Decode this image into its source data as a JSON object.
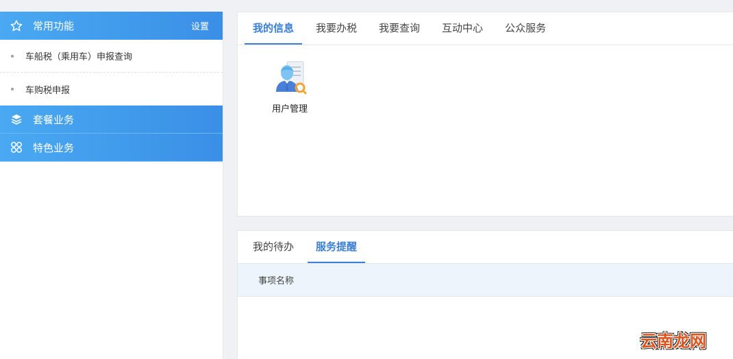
{
  "sidebar": {
    "header": {
      "title": "常用功能",
      "settings_label": "设置",
      "icon": "star-icon"
    },
    "items": [
      {
        "label": "车船税（乘用车）申报查询"
      },
      {
        "label": "车购税申报"
      }
    ],
    "groups": [
      {
        "label": "套餐业务",
        "icon": "layers-icon"
      },
      {
        "label": "特色业务",
        "icon": "grid-icon"
      }
    ]
  },
  "top_panel": {
    "tabs": [
      {
        "label": "我的信息",
        "active": true
      },
      {
        "label": "我要办税"
      },
      {
        "label": "我要查询"
      },
      {
        "label": "互动中心"
      },
      {
        "label": "公众服务"
      }
    ],
    "apps": [
      {
        "label": "用户管理",
        "icon": "user-management-icon"
      }
    ]
  },
  "bottom_panel": {
    "tabs": [
      {
        "label": "我的待办"
      },
      {
        "label": "服务提醒",
        "active": true
      }
    ],
    "table_header": {
      "col_name": "事项名称"
    }
  },
  "watermark": {
    "text": "云南龙网"
  },
  "colors": {
    "accent": "#3a7fd5",
    "sidebar_gradient_start": "#4aa9f2",
    "sidebar_gradient_end": "#3a8fe6"
  }
}
